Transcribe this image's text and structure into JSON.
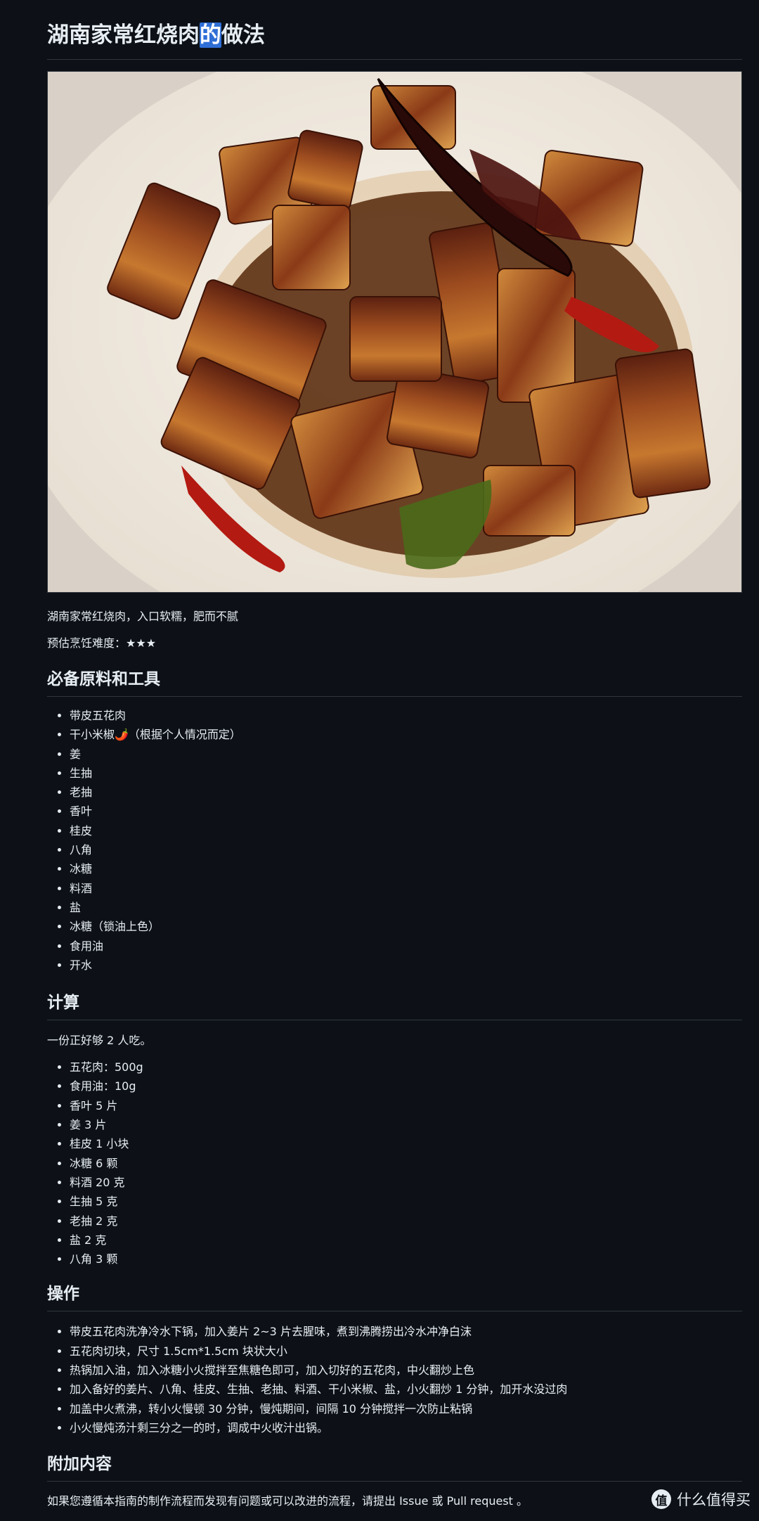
{
  "title": {
    "before": "湖南家常红烧肉",
    "highlight": "的",
    "after": "做法"
  },
  "intro": "湖南家常红烧肉，入口软糯，肥而不腻",
  "difficulty": "预估烹饪难度：★★★",
  "sections": {
    "ingredients": {
      "heading": "必备原料和工具",
      "items": [
        "带皮五花肉",
        "干小米椒🌶️（根据个人情况而定）",
        "姜",
        "生抽",
        "老抽",
        "香叶",
        "桂皮",
        "八角",
        "冰糖",
        "料酒",
        "盐",
        "冰糖（锁油上色）",
        "食用油",
        "开水"
      ]
    },
    "calc": {
      "heading": "计算",
      "note": "一份正好够 2 人吃。",
      "items": [
        "五花肉：500g",
        "食用油：10g",
        "香叶 5 片",
        "姜 3 片",
        "桂皮 1 小块",
        "冰糖 6 颗",
        "料酒 20 克",
        "生抽 5 克",
        "老抽 2 克",
        "盐 2 克",
        "八角 3 颗"
      ]
    },
    "steps": {
      "heading": "操作",
      "items": [
        "带皮五花肉洗净冷水下锅，加入姜片 2~3 片去腥味，煮到沸腾捞出冷水冲净白沫",
        "五花肉切块，尺寸 1.5cm*1.5cm 块状大小",
        "热锅加入油，加入冰糖小火搅拌至焦糖色即可，加入切好的五花肉，中火翻炒上色",
        "加入备好的姜片、八角、桂皮、生抽、老抽、料酒、干小米椒、盐，小火翻炒 1 分钟，加开水没过肉",
        "加盖中火煮沸，转小火慢顿 30 分钟，慢炖期间，间隔 10 分钟搅拌一次防止粘锅",
        "小火慢炖汤汁剩三分之一的时，调成中火收汁出锅。"
      ]
    },
    "extra": {
      "heading": "附加内容",
      "text": "如果您遵循本指南的制作流程而发现有问题或可以改进的流程，请提出 Issue 或 Pull request 。"
    }
  },
  "watermark": {
    "badge": "值",
    "text": "什么值得买"
  }
}
